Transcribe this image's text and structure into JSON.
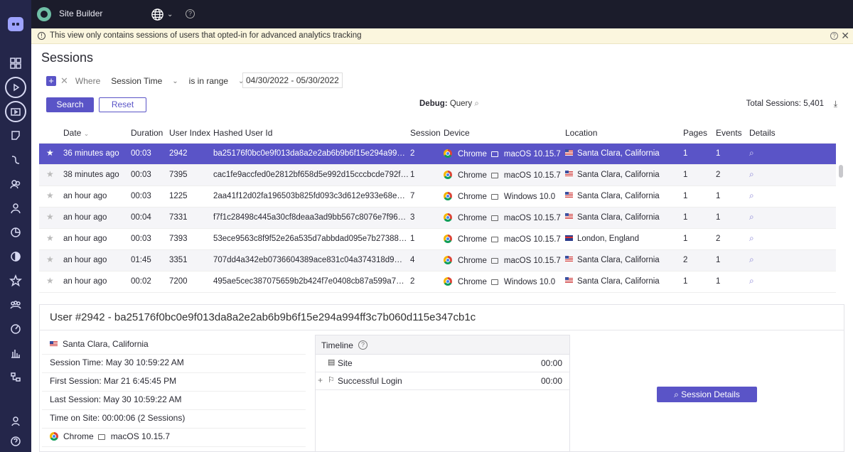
{
  "app": {
    "title": "Site Builder"
  },
  "banner": {
    "text": "This view only contains sessions of users that opted-in for advanced analytics tracking"
  },
  "page": {
    "title": "Sessions"
  },
  "filter": {
    "where_label": "Where",
    "field": "Session Time",
    "operator": "is in range",
    "value": "04/30/2022 - 05/30/2022"
  },
  "buttons": {
    "search": "Search",
    "reset": "Reset",
    "session_details": "Session Details"
  },
  "debug": {
    "label": "Debug:",
    "query": "Query"
  },
  "total": {
    "label": "Total Sessions:",
    "value": "5,401"
  },
  "table": {
    "headers": [
      "Date",
      "Duration",
      "User Index",
      "Hashed User Id",
      "Session",
      "Device",
      "Location",
      "Pages",
      "Events",
      "Details"
    ],
    "rows": [
      {
        "date": "36 minutes ago",
        "duration": "00:03",
        "user_index": "2942",
        "hash": "ba25176f0bc0e9f013da8a2e2ab6b9b6f15e294a99…",
        "session": "2",
        "browser": "Chrome",
        "os": "macOS 10.15.7",
        "location": "Santa Clara, California",
        "country": "us",
        "pages": "1",
        "events": "1",
        "selected": true
      },
      {
        "date": "38 minutes ago",
        "duration": "00:03",
        "user_index": "7395",
        "hash": "cac1fe9accfed0e2812bf658d5e992d15cccbcde792f…",
        "session": "1",
        "browser": "Chrome",
        "os": "macOS 10.15.7",
        "location": "Santa Clara, California",
        "country": "us",
        "pages": "1",
        "events": "2"
      },
      {
        "date": "an hour ago",
        "duration": "00:03",
        "user_index": "1225",
        "hash": "2aa41f12d02fa196503b825fd093c3d612e933e68e…",
        "session": "7",
        "browser": "Chrome",
        "os": "Windows 10.0",
        "location": "Santa Clara, California",
        "country": "us",
        "pages": "1",
        "events": "1"
      },
      {
        "date": "an hour ago",
        "duration": "00:04",
        "user_index": "7331",
        "hash": "f7f1c28498c445a30cf8deaa3ad9bb567c8076e7f96…",
        "session": "3",
        "browser": "Chrome",
        "os": "macOS 10.15.7",
        "location": "Santa Clara, California",
        "country": "us",
        "pages": "1",
        "events": "1"
      },
      {
        "date": "an hour ago",
        "duration": "00:03",
        "user_index": "7393",
        "hash": "53ece9563c8f9f52e26a535d7abbdad095e7b27388…",
        "session": "1",
        "browser": "Chrome",
        "os": "macOS 10.15.7",
        "location": "London, England",
        "country": "uk",
        "pages": "1",
        "events": "2"
      },
      {
        "date": "an hour ago",
        "duration": "01:45",
        "user_index": "3351",
        "hash": "707dd4a342eb0736604389ace831c04a374318d9…",
        "session": "4",
        "browser": "Chrome",
        "os": "macOS 10.15.7",
        "location": "Santa Clara, California",
        "country": "us",
        "pages": "2",
        "events": "1"
      },
      {
        "date": "an hour ago",
        "duration": "00:02",
        "user_index": "7200",
        "hash": "495ae5cec387075659b2b424f7e0408cb87a599a7…",
        "session": "2",
        "browser": "Chrome",
        "os": "Windows 10.0",
        "location": "Santa Clara, California",
        "country": "us",
        "pages": "1",
        "events": "1"
      }
    ]
  },
  "detail": {
    "title": "User #2942 - ba25176f0bc0e9f013da8a2e2ab6b9b6f15e294a994ff3c7b060d115e347cb1c",
    "location": "Santa Clara, California",
    "session_time": "Session Time: May 30 10:59:22 AM",
    "first_session": "First Session: Mar 21 6:45:45 PM",
    "last_session": "Last Session: May 30 10:59:22 AM",
    "time_on_site": "Time on Site: 00:00:06 (2 Sessions)",
    "browser": "Chrome",
    "os": "macOS 10.15.7",
    "timeline": {
      "title": "Timeline",
      "items": [
        {
          "label": "Site",
          "time": "00:00"
        },
        {
          "label": "Successful Login",
          "time": "00:00"
        }
      ]
    }
  },
  "colors": {
    "accent": "#5a54c7",
    "sidebar": "#24264a",
    "topbar": "#1b1c2b",
    "banner": "#fbf6de"
  }
}
